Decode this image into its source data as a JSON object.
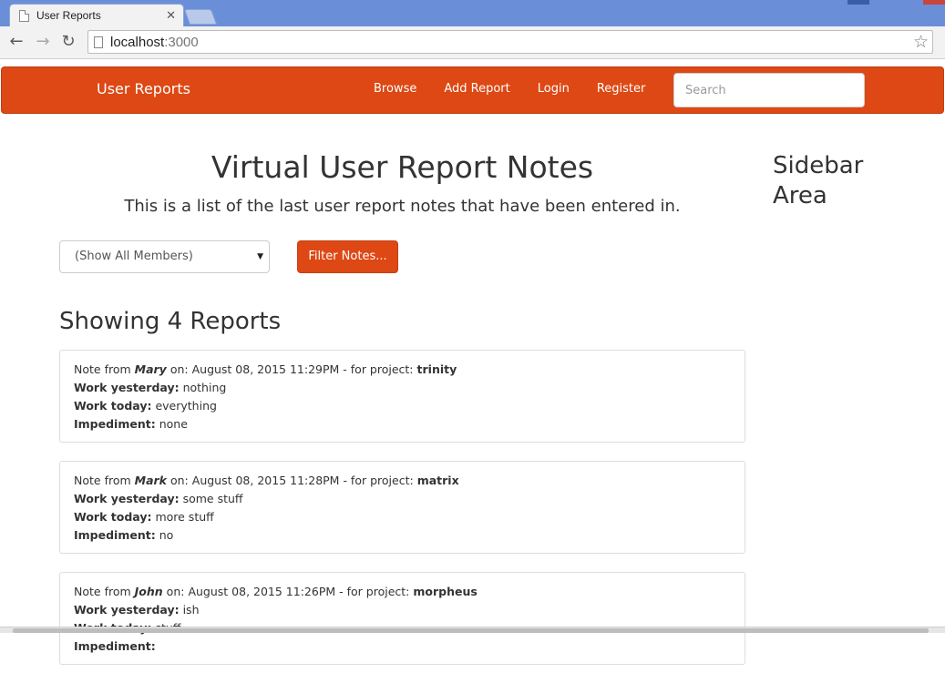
{
  "browser": {
    "tab_title": "User Reports",
    "tab_close": "✕",
    "url_host": "localhost",
    "url_port": ":3000",
    "back_glyph": "←",
    "forward_glyph": "→",
    "reload_glyph": "↻",
    "star_glyph": "☆"
  },
  "navbar": {
    "brand": "User Reports",
    "links": [
      "Browse",
      "Add Report",
      "Login",
      "Register"
    ],
    "search_placeholder": "Search",
    "color": "#dd4814"
  },
  "main": {
    "title": "Virtual User Report Notes",
    "subtitle": "This is a list of the last user report notes that have been entered in.",
    "member_filter": "(Show All Members)",
    "filter_button": "Filter Notes...",
    "count_heading": "Showing 4 Reports",
    "labels": {
      "note_from": "Note from",
      "on": "on:",
      "for_project": "- for project:",
      "work_yesterday": "Work yesterday:",
      "work_today": "Work today:",
      "impediment": "Impediment:"
    },
    "reports": [
      {
        "author": "Mary",
        "date": "August 08, 2015 11:29PM",
        "project": "trinity",
        "yesterday": "nothing",
        "today": "everything",
        "impediment": "none"
      },
      {
        "author": "Mark",
        "date": "August 08, 2015 11:28PM",
        "project": "matrix",
        "yesterday": "some stuff",
        "today": "more stuff",
        "impediment": "no"
      },
      {
        "author": "John",
        "date": "August 08, 2015 11:26PM",
        "project": "morpheus",
        "yesterday": "ish",
        "today": "stuff",
        "impediment": ""
      }
    ]
  },
  "sidebar": {
    "title": "Sidebar Area"
  }
}
